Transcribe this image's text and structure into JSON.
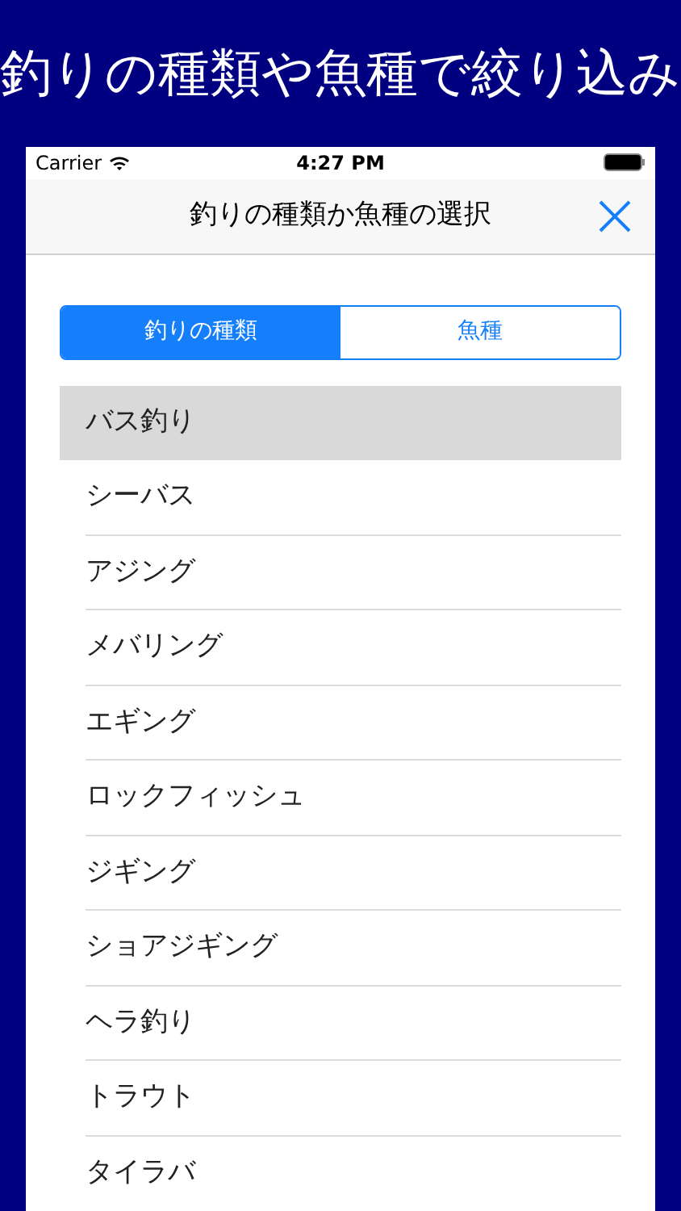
{
  "headline": "釣りの種類や魚種で絞り込み",
  "status_bar": {
    "carrier": "Carrier",
    "time": "4:27 PM"
  },
  "nav": {
    "title": "釣りの種類か魚種の選択"
  },
  "tabs": [
    {
      "label": "釣りの種類",
      "selected": true
    },
    {
      "label": "魚種",
      "selected": false
    }
  ],
  "items": [
    {
      "label": "バス釣り",
      "selected": true
    },
    {
      "label": "シーバス",
      "selected": false
    },
    {
      "label": "アジング",
      "selected": false
    },
    {
      "label": "メバリング",
      "selected": false
    },
    {
      "label": "エギング",
      "selected": false
    },
    {
      "label": "ロックフィッシュ",
      "selected": false
    },
    {
      "label": "ジギング",
      "selected": false
    },
    {
      "label": "ショアジギング",
      "selected": false
    },
    {
      "label": "ヘラ釣り",
      "selected": false
    },
    {
      "label": "トラウト",
      "selected": false
    },
    {
      "label": "タイラバ",
      "selected": false
    }
  ]
}
